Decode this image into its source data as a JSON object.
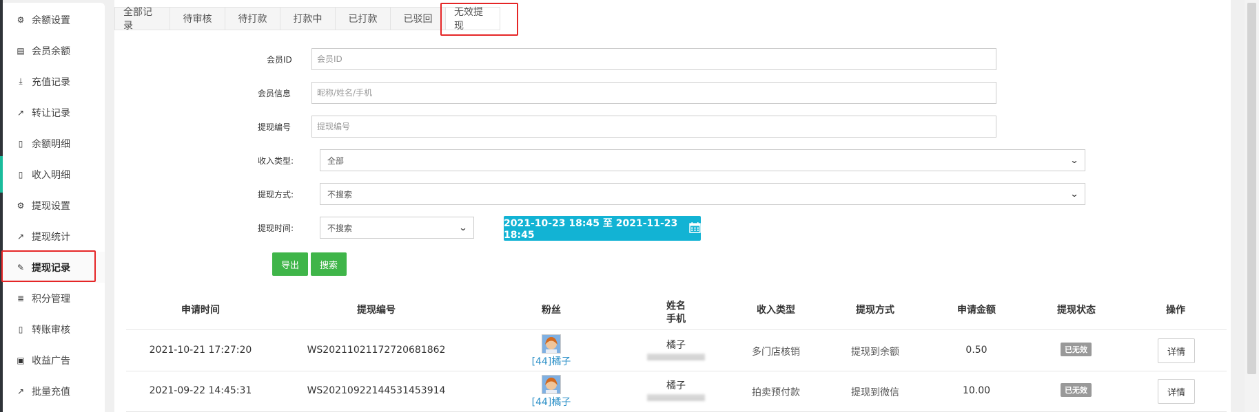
{
  "sidebar": {
    "items": [
      {
        "label": "余额设置",
        "icon": "gear-icon"
      },
      {
        "label": "会员余额",
        "icon": "book-icon"
      },
      {
        "label": "充值记录",
        "icon": "download-icon"
      },
      {
        "label": "转让记录",
        "icon": "external-link-icon"
      },
      {
        "label": "余额明细",
        "icon": "file-icon"
      },
      {
        "label": "收入明细",
        "icon": "file-icon"
      },
      {
        "label": "提现设置",
        "icon": "gear-icon"
      },
      {
        "label": "提现统计",
        "icon": "line-chart-icon"
      },
      {
        "label": "提现记录",
        "icon": "pencil-icon"
      },
      {
        "label": "积分管理",
        "icon": "database-icon"
      },
      {
        "label": "转账审核",
        "icon": "file-icon"
      },
      {
        "label": "收益广告",
        "icon": "image-icon"
      },
      {
        "label": "批量充值",
        "icon": "line-chart-icon"
      }
    ],
    "active_index": 8
  },
  "tabs": [
    "全部记录",
    "待审核",
    "待打款",
    "打款中",
    "已打款",
    "已驳回",
    "无效提现"
  ],
  "active_tab": 6,
  "form": {
    "member_id": {
      "label": "会员ID",
      "placeholder": "会员ID"
    },
    "member_info": {
      "label": "会员信息",
      "placeholder": "昵称/姓名/手机"
    },
    "withdraw_no": {
      "label": "提现编号",
      "placeholder": "提现编号"
    },
    "income_type": {
      "label": "收入类型:",
      "value": "全部"
    },
    "withdraw_method": {
      "label": "提现方式:",
      "value": "不搜索"
    },
    "withdraw_time": {
      "label": "提现时间:",
      "value": "不搜索"
    },
    "date_range": "2021-10-23 18:45 至 2021-11-23 18:45",
    "export_label": "导出",
    "search_label": "搜索"
  },
  "table": {
    "headers": {
      "apply_time": "申请时间",
      "withdraw_no": "提现编号",
      "fan": "粉丝",
      "name": "姓名",
      "phone": "手机",
      "income_type": "收入类型",
      "method": "提现方式",
      "amount": "申请金额",
      "status": "提现状态",
      "action": "操作"
    },
    "rows": [
      {
        "apply_time": "2021-10-21 17:27:20",
        "withdraw_no": "WS20211021172720681862",
        "fan": "[44]橘子",
        "name": "橘子",
        "income_type": "多门店核销",
        "method": "提现到余额",
        "amount": "0.50",
        "status": "已无效",
        "action": "详情"
      },
      {
        "apply_time": "2021-09-22 14:45:31",
        "withdraw_no": "WS20210922144531453914",
        "fan": "[44]橘子",
        "name": "橘子",
        "income_type": "拍卖预付款",
        "method": "提现到微信",
        "amount": "10.00",
        "status": "已无效",
        "action": "详情"
      }
    ]
  },
  "colors": {
    "accent_teal": "#12b3d4",
    "btn_green": "#3fb549",
    "highlight_red": "#e52526",
    "link_blue": "#2a8fc7"
  }
}
